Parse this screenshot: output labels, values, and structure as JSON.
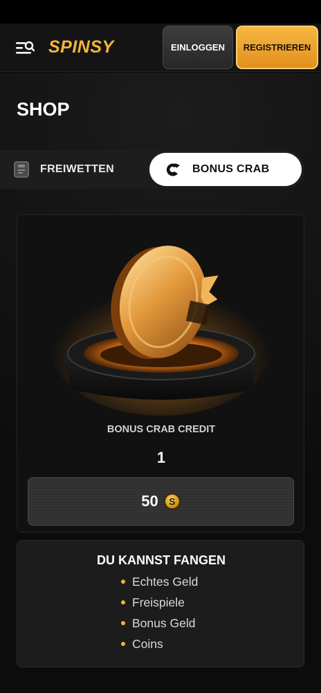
{
  "header": {
    "logo_text": "SPINSY",
    "login_label": "EINLOGGEN",
    "register_label": "REGISTRIEREN",
    "menu_icon": "menu-search-icon"
  },
  "page": {
    "title": "SHOP"
  },
  "tabs": [
    {
      "label": "FREIWETTEN",
      "icon": "ticket-icon",
      "active": false
    },
    {
      "label": "BONUS CRAB",
      "icon": "crab-claw-icon",
      "active": true
    }
  ],
  "product": {
    "name": "BONUS CRAB CREDIT",
    "quantity": "1",
    "price": "50",
    "currency_symbol": "S",
    "currency_icon": "coin-icon"
  },
  "info": {
    "title": "DU KANNST FANGEN",
    "items": [
      "Echtes Geld",
      "Freispiele",
      "Bonus Geld",
      "Coins"
    ]
  },
  "colors": {
    "accent": "#f2b53a",
    "background": "#0b0b0b",
    "card": "#111111"
  }
}
